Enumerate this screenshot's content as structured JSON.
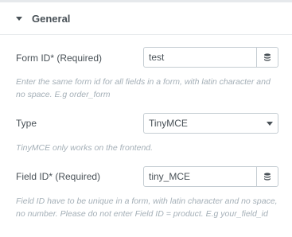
{
  "section": {
    "title": "General",
    "expanded": true
  },
  "fields": {
    "form_id": {
      "label": "Form ID* (Required)",
      "value": "test",
      "help": "Enter the same form id for all fields in a form, with latin character and no space. E.g order_form",
      "dynamic_icon": "database-icon"
    },
    "type": {
      "label": "Type",
      "value": "TinyMCE",
      "help": "TinyMCE only works on the frontend."
    },
    "field_id": {
      "label": "Field ID* (Required)",
      "value": "tiny_MCE",
      "help": "Field ID have to be unique in a form, with latin character and no space, no number. Please do not enter Field ID = product. E.g your_field_id",
      "dynamic_icon": "database-icon"
    }
  },
  "colors": {
    "label": "#495157",
    "help": "#a4afb7",
    "border": "#c5cdd3",
    "divider": "#e6e9ec"
  }
}
